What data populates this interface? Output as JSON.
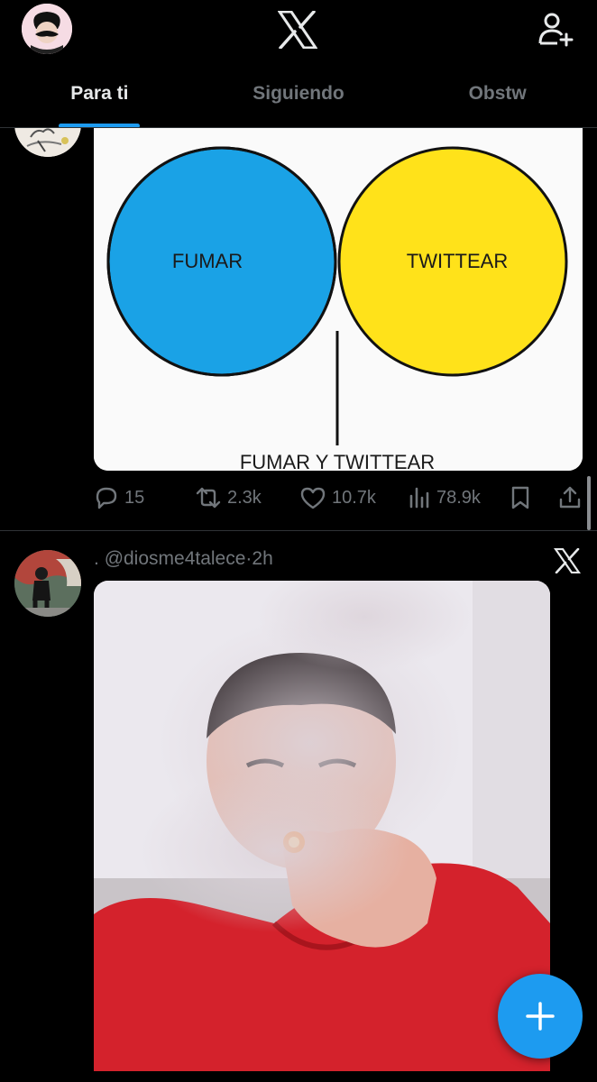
{
  "header": {
    "tabs": [
      {
        "label": "Para ti",
        "active": true
      },
      {
        "label": "Siguiendo",
        "active": false
      },
      {
        "label": "Obstw",
        "active": false
      }
    ],
    "logo_icon": "x-logo-icon",
    "right_icon": "add-user-icon"
  },
  "tweet1": {
    "media": {
      "left_circle": "FUMAR",
      "right_circle": "TWITTEAR",
      "intersection_label": "FUMAR Y TWITTEAR",
      "colors": {
        "left": "#1aa2e6",
        "right": "#ffe21a",
        "overlap": "#6cb52d"
      }
    },
    "actions": {
      "replies": "15",
      "retweets": "2.3k",
      "likes": "10.7k",
      "views": "78.9k"
    }
  },
  "tweet2": {
    "prefix": ".",
    "handle": "@diosme4talece",
    "separator": "·",
    "time": "2h"
  },
  "fab": {
    "icon": "plus-icon"
  },
  "colors": {
    "accent": "#1d9bf0",
    "muted": "#71767b",
    "background": "#000000"
  }
}
